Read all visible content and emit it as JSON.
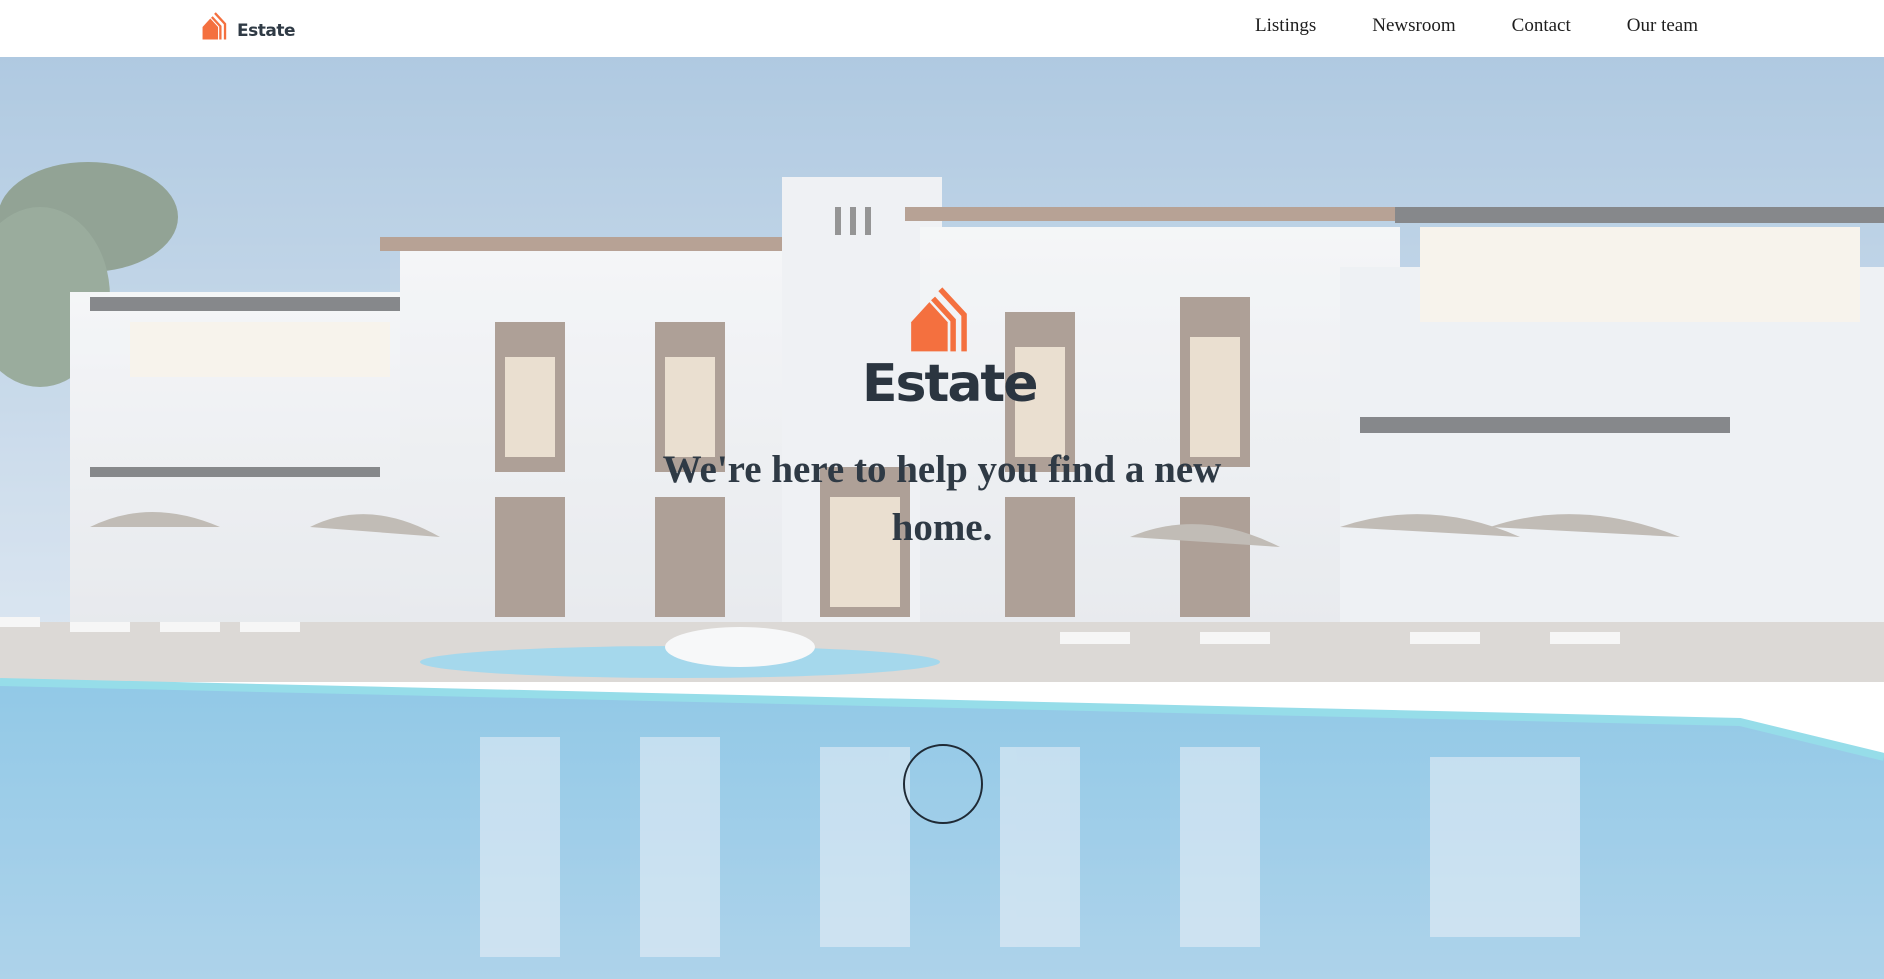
{
  "header": {
    "brand_name": "Estate",
    "brand_icon": "house-icon",
    "nav": [
      {
        "label": "Listings"
      },
      {
        "label": "Newsroom"
      },
      {
        "label": "Contact"
      },
      {
        "label": "Our team"
      }
    ]
  },
  "hero": {
    "logo_name": "Estate",
    "logo_icon": "house-icon",
    "tagline": "We're here to help you find a new home.",
    "scroll_button_icon": "circle-icon"
  },
  "colors": {
    "accent": "#f4703f",
    "text_dark": "#2f3a45",
    "nav_text": "#1e1e1e"
  }
}
